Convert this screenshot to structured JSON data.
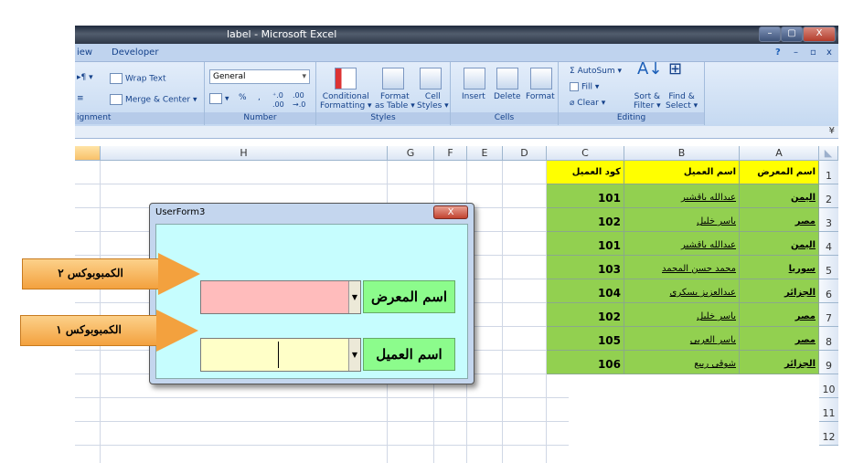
{
  "window": {
    "title": "label - Microsoft Excel",
    "min": "–",
    "max": "▢",
    "close": "X"
  },
  "menu": {
    "tabs": [
      "iew",
      "Developer"
    ],
    "help": "?",
    "sub_min": "–",
    "sub_restore": "▫",
    "sub_close": "x"
  },
  "ribbon": {
    "alignment": {
      "label": "ignment",
      "wrap": "Wrap Text",
      "merge": "Merge & Center"
    },
    "number": {
      "label": "Number",
      "format": "General",
      "percent": "%",
      "comma": ","
    },
    "styles": {
      "label": "Styles",
      "cond": "Conditional",
      "cond2": "Formatting",
      "fmt": "Format",
      "fmt2": "as Table",
      "cell": "Cell",
      "cell2": "Styles"
    },
    "cells": {
      "label": "Cells",
      "insert": "Insert",
      "delete": "Delete",
      "format": "Format"
    },
    "editing": {
      "label": "Editing",
      "autosum": "AutoSum",
      "fill": "Fill",
      "clear": "Clear",
      "sort": "Sort &",
      "sort2": "Filter",
      "find": "Find &",
      "find2": "Select"
    }
  },
  "sheet": {
    "columns": [
      "H",
      "G",
      "F",
      "E",
      "D",
      "C",
      "B",
      "A"
    ],
    "rows": [
      "1",
      "2",
      "3",
      "4",
      "5",
      "6",
      "7",
      "8",
      "9",
      "10",
      "11",
      "12"
    ],
    "headers": {
      "a": "اسم المعرض",
      "b": "اسم العميل",
      "c": "كود العميل"
    },
    "data": [
      {
        "a": "اليمن",
        "b": "عبدالله باقشير",
        "c": "101"
      },
      {
        "a": "مصر",
        "b": "ياسر خليل",
        "c": "102"
      },
      {
        "a": "اليمن",
        "b": "عبدالله باقشير",
        "c": "101"
      },
      {
        "a": "سوريا",
        "b": "محمد حسن المحمد",
        "c": "103"
      },
      {
        "a": "الجزائر",
        "b": "عبدالعزيز يسكرى",
        "c": "104"
      },
      {
        "a": "مصر",
        "b": "ياسر خليل",
        "c": "102"
      },
      {
        "a": "مصر",
        "b": "ياسر العربى",
        "c": "105"
      },
      {
        "a": "الجزائر",
        "b": "شوقى ربيع",
        "c": "106"
      }
    ]
  },
  "userform": {
    "title": "UserForm3",
    "close": "X",
    "label_showroom": "اسم المعرض",
    "label_client": "اسم العميل",
    "combo1_value": "",
    "combo2_value": ""
  },
  "callouts": {
    "combo2": "الكمبوبوكس ٢",
    "combo1": "الكمبوبوكس ١"
  },
  "colors": {
    "header_yellow": "#ffff00",
    "data_green": "#92d050",
    "combo_pink": "#ffbcbc",
    "combo_yellow": "#ffffc8",
    "form_client": "#c6fdfe"
  }
}
